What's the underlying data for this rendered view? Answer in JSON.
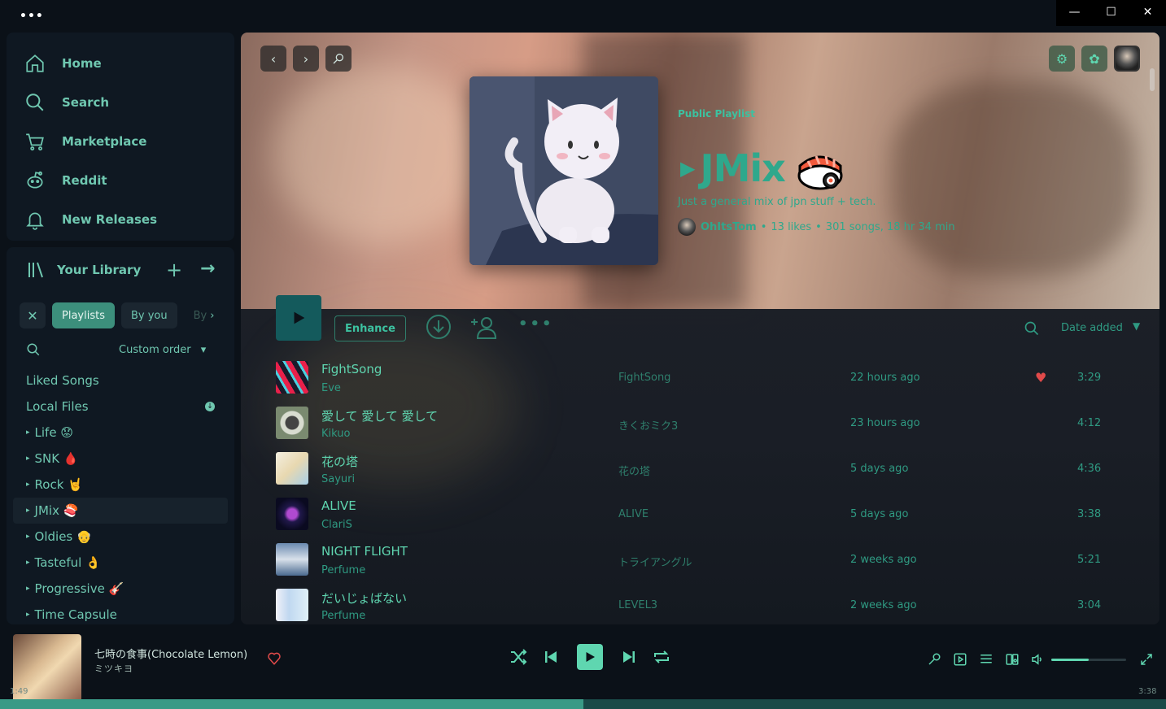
{
  "window": {
    "menu_dots": "•••",
    "minimize": "—",
    "maximize": "☐",
    "close": "✕"
  },
  "nav": [
    {
      "label": "Home",
      "icon": "home-icon"
    },
    {
      "label": "Search",
      "icon": "search-icon"
    },
    {
      "label": "Marketplace",
      "icon": "cart-icon"
    },
    {
      "label": "Reddit",
      "icon": "reddit-icon"
    },
    {
      "label": "New Releases",
      "icon": "bell-icon"
    }
  ],
  "library": {
    "title": "Your Library",
    "chips": {
      "playlists": "Playlists",
      "by_you": "By you",
      "by_spotify": "By"
    },
    "sort": "Custom order",
    "items": [
      "Liked Songs",
      "Local Files",
      "Life 😟",
      "SNK 🩸",
      "Rock 🤘",
      "JMix 🍣",
      "Oldies 👴",
      "Tasteful 👌",
      "Progressive 🎸",
      "Time Capsule"
    ]
  },
  "playlist": {
    "type": "Public Playlist",
    "name": "JMix",
    "description": "Just a general mix of jpn stuff + tech.",
    "owner": "OhItsTom",
    "likes": "13 likes",
    "stats": "301 songs, 18 hr 34 min"
  },
  "actions": {
    "enhance": "Enhance",
    "sort_label": "Date added",
    "more": "•••"
  },
  "tracks": [
    {
      "title": "FightSong",
      "artist": "Eve",
      "album": "FightSong",
      "added": "22 hours ago",
      "duration": "3:29",
      "liked": true
    },
    {
      "title": "愛して 愛して 愛して",
      "artist": "Kikuo",
      "album": "きくおミク3",
      "added": "23 hours ago",
      "duration": "4:12",
      "liked": false
    },
    {
      "title": "花の塔",
      "artist": "Sayuri",
      "album": "花の塔",
      "added": "5 days ago",
      "duration": "4:36",
      "liked": false
    },
    {
      "title": "ALIVE",
      "artist": "ClariS",
      "album": "ALIVE",
      "added": "5 days ago",
      "duration": "3:38",
      "liked": false
    },
    {
      "title": "NIGHT FLIGHT",
      "artist": "Perfume",
      "album": "トライアングル",
      "added": "2 weeks ago",
      "duration": "5:21",
      "liked": false
    },
    {
      "title": "だいじょばない",
      "artist": "Perfume",
      "album": "LEVEL3",
      "added": "2 weeks ago",
      "duration": "3:04",
      "liked": false
    }
  ],
  "now_playing": {
    "title": "七時の食事(Chocolate Lemon)",
    "artist": "ミツキヨ",
    "elapsed": "1:49",
    "total": "3:38",
    "progress_fraction": 0.5,
    "volume_fraction": 0.5
  },
  "colors": {
    "accent": "#5fd6b0",
    "accent_dark": "#2f9a82",
    "heart": "#e14a4a",
    "panel": "#0f1822"
  }
}
